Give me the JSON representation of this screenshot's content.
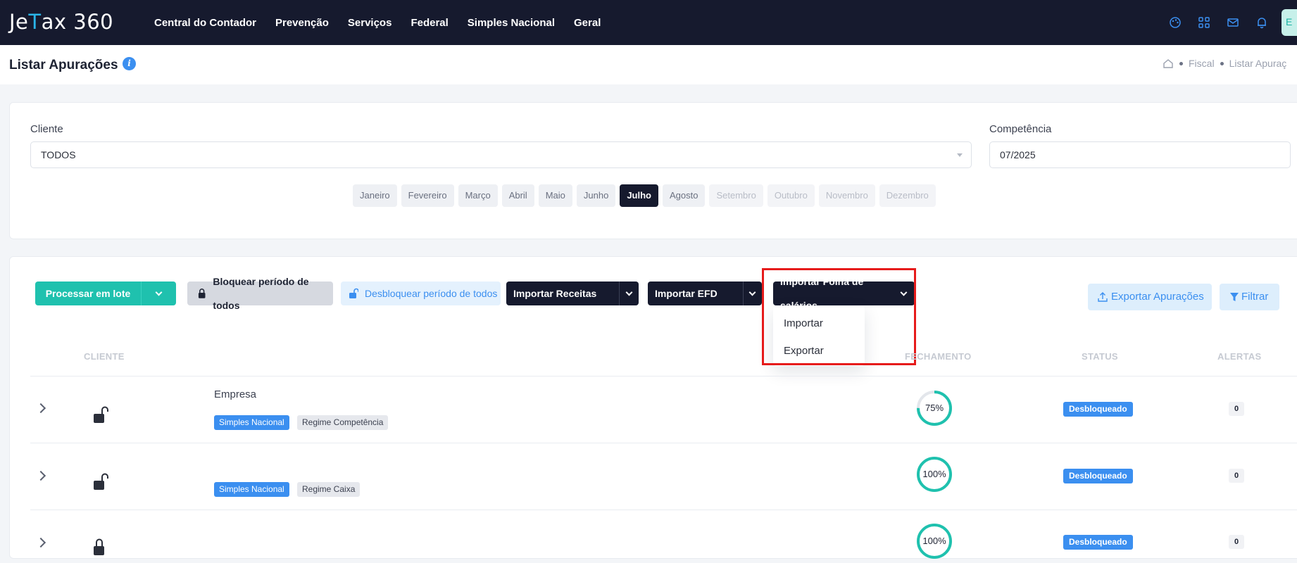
{
  "brand": {
    "logo_text_1": "Je",
    "logo_text_mark": "T",
    "logo_text_2": "ax 360"
  },
  "nav": [
    "Central do Contador",
    "Prevenção",
    "Serviços",
    "Federal",
    "Simples Nacional",
    "Geral"
  ],
  "header": {
    "title": "Listar Apurações",
    "breadcrumb": [
      "Fiscal",
      "Listar Apuraç"
    ]
  },
  "filters": {
    "cliente_label": "Cliente",
    "cliente_value": "TODOS",
    "competencia_label": "Competência",
    "competencia_value": "07/2025",
    "months": [
      {
        "label": "Janeiro",
        "state": "normal"
      },
      {
        "label": "Fevereiro",
        "state": "normal"
      },
      {
        "label": "Março",
        "state": "normal"
      },
      {
        "label": "Abril",
        "state": "normal"
      },
      {
        "label": "Maio",
        "state": "normal"
      },
      {
        "label": "Junho",
        "state": "normal"
      },
      {
        "label": "Julho",
        "state": "active"
      },
      {
        "label": "Agosto",
        "state": "normal"
      },
      {
        "label": "Setembro",
        "state": "disabled"
      },
      {
        "label": "Outubro",
        "state": "disabled"
      },
      {
        "label": "Novembro",
        "state": "disabled"
      },
      {
        "label": "Dezembro",
        "state": "disabled"
      }
    ]
  },
  "toolbar": {
    "process_batch": "Processar em lote",
    "lock_all": "Bloquear período de todos",
    "unlock_all": "Desbloquear período de todos",
    "import_das": "Importar Receitas DAS",
    "import_efd": "Importar EFD Reinf",
    "import_folha": "Importar Folha de salários",
    "export": "Exportar Apurações",
    "filter": "Filtrar"
  },
  "dropdown": {
    "items": [
      "Importar",
      "Exportar"
    ]
  },
  "table": {
    "headers": {
      "cliente": "CLIENTE",
      "fechamento": "FECHAMENTO",
      "status": "STATUS",
      "alertas": "ALERTAS"
    },
    "rows": [
      {
        "company": "Empresa",
        "tags": [
          "Simples Nacional",
          "Regime Competência"
        ],
        "progress": 75,
        "progress_label": "75%",
        "status": "Desbloqueado",
        "alerts": "0"
      },
      {
        "company": "",
        "tags": [
          "Simples Nacional",
          "Regime Caixa"
        ],
        "progress": 100,
        "progress_label": "100%",
        "status": "Desbloqueado",
        "alerts": "0"
      },
      {
        "company": "",
        "tags": [],
        "progress": 100,
        "progress_label": "100%",
        "status": "Desbloqueado",
        "alerts": "0"
      }
    ]
  },
  "colors": {
    "nav_bg": "#161a2e",
    "accent_teal": "#1fc1ae",
    "accent_blue": "#3b8ff0",
    "highlight_red": "#e61b1b"
  }
}
